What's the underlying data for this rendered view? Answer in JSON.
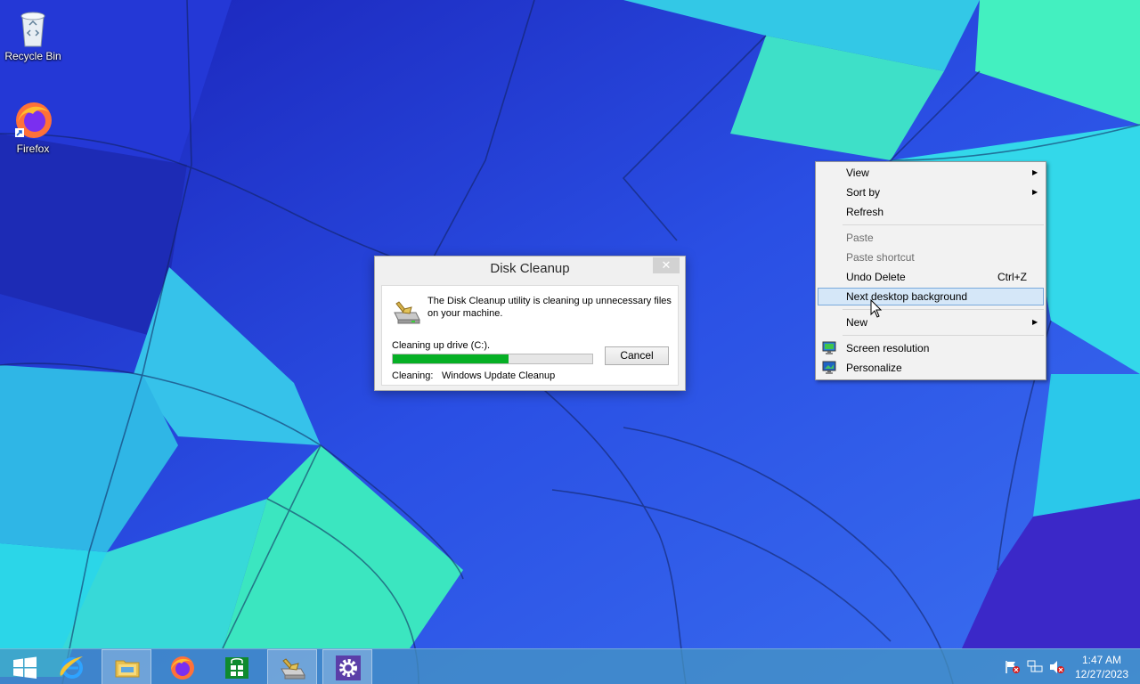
{
  "desktop": {
    "icons": [
      {
        "label": "Recycle Bin",
        "icon": "recycle-bin-icon"
      },
      {
        "label": "Firefox",
        "icon": "firefox-icon"
      }
    ]
  },
  "disk_cleanup": {
    "title": "Disk Cleanup",
    "close_glyph": "✕",
    "message": "The Disk Cleanup utility is cleaning up unnecessary files on your machine.",
    "status": "Cleaning up drive  (C:).",
    "progress": 0.58,
    "cancel_label": "Cancel",
    "cleaning_label": "Cleaning:",
    "cleaning_value": "Windows Update Cleanup"
  },
  "context_menu": {
    "items": [
      {
        "label": "View",
        "submenu": true
      },
      {
        "label": "Sort by",
        "submenu": true
      },
      {
        "label": "Refresh"
      },
      {
        "label": "Paste",
        "disabled": true
      },
      {
        "label": "Paste shortcut",
        "disabled": true
      },
      {
        "label": "Undo Delete",
        "shortcut": "Ctrl+Z"
      },
      {
        "label": "Next desktop background",
        "highlighted": true
      },
      {
        "label": "New",
        "submenu": true
      },
      {
        "label": "Screen resolution",
        "icon": "monitor-icon"
      },
      {
        "label": "Personalize",
        "icon": "personalize-icon"
      }
    ],
    "submenu_glyph": "▶"
  },
  "taskbar": {
    "buttons": [
      {
        "name": "start-button",
        "icon": "windows-logo-icon"
      },
      {
        "name": "internet-explorer-button",
        "icon": "internet-explorer-icon"
      },
      {
        "name": "file-explorer-button",
        "icon": "folder-icon",
        "active": true
      },
      {
        "name": "firefox-button",
        "icon": "firefox-icon"
      },
      {
        "name": "store-button",
        "icon": "store-icon"
      },
      {
        "name": "disk-cleanup-button",
        "icon": "disk-cleanup-icon",
        "active": true
      },
      {
        "name": "settings-button",
        "icon": "gear-icon"
      }
    ],
    "tray": [
      "action-center-flag-icon",
      "network-icon",
      "volume-muted-icon"
    ],
    "time": "1:47 AM",
    "date": "12/27/2023"
  }
}
